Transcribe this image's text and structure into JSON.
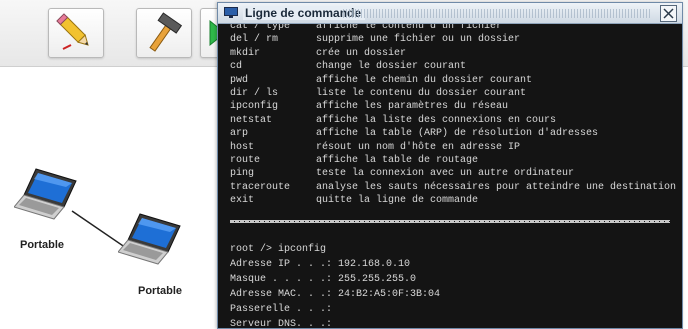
{
  "window": {
    "title": "Ligne de commande"
  },
  "help": [
    {
      "cmd": "cat / type",
      "desc": "affiche le contenu d'un fichier"
    },
    {
      "cmd": "del / rm",
      "desc": "supprime une fichier ou un dossier"
    },
    {
      "cmd": "mkdir",
      "desc": "crée un dossier"
    },
    {
      "cmd": "cd",
      "desc": "change le dossier courant"
    },
    {
      "cmd": "pwd",
      "desc": "affiche le chemin du dossier courant"
    },
    {
      "cmd": "dir / ls",
      "desc": "liste le contenu du dossier courant"
    },
    {
      "cmd": "ipconfig",
      "desc": "affiche les paramètres du réseau"
    },
    {
      "cmd": "netstat",
      "desc": "affiche la liste des connexions en cours"
    },
    {
      "cmd": "arp",
      "desc": "affiche la table (ARP) de résolution d'adresses"
    },
    {
      "cmd": "host",
      "desc": "résout un nom d'hôte en adresse IP"
    },
    {
      "cmd": "route",
      "desc": "affiche la table de routage"
    },
    {
      "cmd": "ping",
      "desc": "teste la connexion avec un autre ordinateur"
    },
    {
      "cmd": "traceroute",
      "desc": "analyse les sauts nécessaires pour atteindre une destination"
    },
    {
      "cmd": "exit",
      "desc": "quitte la ligne de commande"
    }
  ],
  "output": {
    "prompt": "root /> ipconfig",
    "ip": "Adresse IP . . .: 192.168.0.10",
    "mask": "Masque . . . . .: 255.255.255.0",
    "mac": "Adresse MAC. . .: 24:B2:A5:0F:3B:04",
    "gateway": "Passerelle . . .:",
    "dns": "Serveur DNS. . .:"
  },
  "devices": {
    "laptop1_label": "Portable",
    "laptop2_label": "Portable"
  },
  "icons": {
    "tool1": "pencil-icon",
    "tool2": "hammer-icon",
    "tool3": "play-icon",
    "window": "monitor-icon"
  }
}
